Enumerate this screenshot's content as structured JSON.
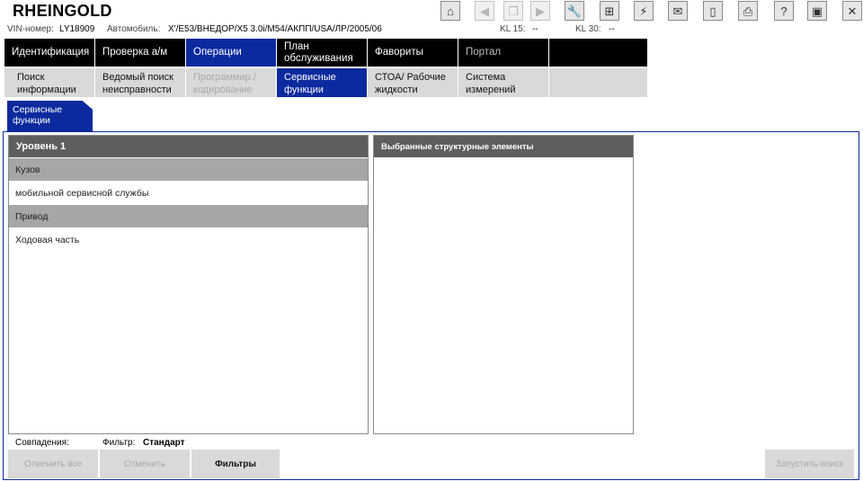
{
  "app": {
    "title": "RHEINGOLD"
  },
  "toolbar": [
    {
      "name": "home-icon",
      "glyph": "⌂",
      "disabled": false
    },
    {
      "name": "back-icon",
      "glyph": "◀",
      "disabled": true
    },
    {
      "name": "copy-icon",
      "glyph": "❐",
      "disabled": true
    },
    {
      "name": "forward-icon",
      "glyph": "▶",
      "disabled": true
    },
    {
      "name": "wrench-icon",
      "glyph": "🔧",
      "disabled": false
    },
    {
      "name": "compare-icon",
      "glyph": "⊞",
      "disabled": false
    },
    {
      "name": "plug-icon",
      "glyph": "⚡",
      "disabled": false
    },
    {
      "name": "mail-icon",
      "glyph": "✉",
      "disabled": false
    },
    {
      "name": "battery-icon",
      "glyph": "▯",
      "disabled": false
    },
    {
      "name": "print-icon",
      "glyph": "⎙",
      "disabled": false
    },
    {
      "name": "help-icon",
      "glyph": "?",
      "disabled": false
    },
    {
      "name": "minimize-icon",
      "glyph": "▣",
      "disabled": false
    },
    {
      "name": "close-icon",
      "glyph": "✕",
      "disabled": false
    }
  ],
  "info": {
    "vin_label": "VIN-номер:",
    "vin_value": "LY18909",
    "car_label": "Автомобиль:",
    "car_value": "X'/E53/ВНЕДОР/X5 3.0i/M54/АКПП/USA/ЛР/2005/06",
    "kl15_label": "KL 15:",
    "kl15_value": "--",
    "kl30_label": "KL 30:",
    "kl30_value": "--"
  },
  "nav_main": [
    {
      "label": "Идентификация",
      "state": "normal"
    },
    {
      "label": "Проверка а/м",
      "state": "normal"
    },
    {
      "label": "Операции",
      "state": "active"
    },
    {
      "label": "План обслуживания",
      "state": "normal"
    },
    {
      "label": "Фавориты",
      "state": "normal"
    },
    {
      "label": "Портал",
      "state": "dim"
    },
    {
      "label": "",
      "state": "blank"
    }
  ],
  "nav_sub": [
    {
      "label": "Поиск информации",
      "state": "normal"
    },
    {
      "label": "Ведомый поиск неисправности",
      "state": "normal"
    },
    {
      "label": "Программир./ кодирование",
      "state": "disabled"
    },
    {
      "label": "Сервисные функции",
      "state": "active"
    },
    {
      "label": "СТОА/ Рабочие жидкости",
      "state": "normal"
    },
    {
      "label": "Система измерений",
      "state": "normal"
    },
    {
      "label": "",
      "state": "blank"
    }
  ],
  "subtab": {
    "label": "Сервисные функции"
  },
  "left_panel": {
    "header": "Уровень 1",
    "rows": [
      {
        "label": "Кузов",
        "kind": "cat"
      },
      {
        "label": "мобильной сервисной службы",
        "kind": "item"
      },
      {
        "label": "Привод",
        "kind": "cat"
      },
      {
        "label": "Ходовая часть",
        "kind": "item"
      }
    ]
  },
  "right_panel": {
    "header": "Выбранные структурные элементы"
  },
  "status": {
    "matches_label": "Совпадения:",
    "filter_label": "Фильтр:",
    "filter_value": "Стандарт"
  },
  "buttons": {
    "cancel_all": "Отменить все",
    "cancel": "Отменить",
    "filters": "Фильтры",
    "start_search": "Запустить поиск"
  }
}
